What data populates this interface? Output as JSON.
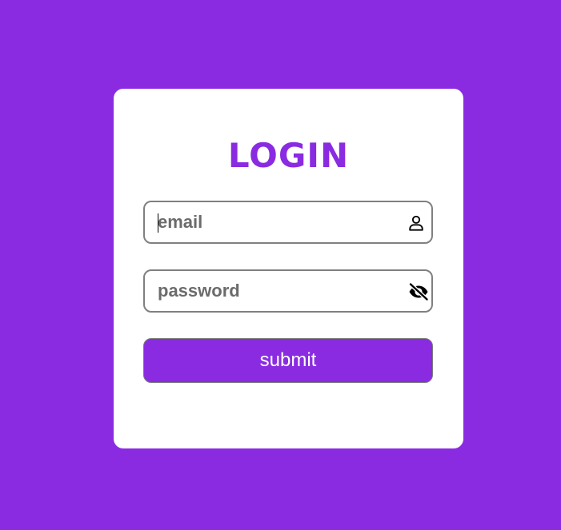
{
  "login": {
    "title": "LOGIN",
    "email": {
      "placeholder": "email",
      "value": "",
      "icon": "user-icon"
    },
    "password": {
      "placeholder": "password",
      "value": "",
      "icon": "eye-slash-icon"
    },
    "submit_label": "submit"
  },
  "colors": {
    "background": "#8a2be2",
    "card": "#ffffff",
    "accent": "#8a2be2",
    "border": "#808080",
    "placeholder": "#6b6b6b"
  }
}
